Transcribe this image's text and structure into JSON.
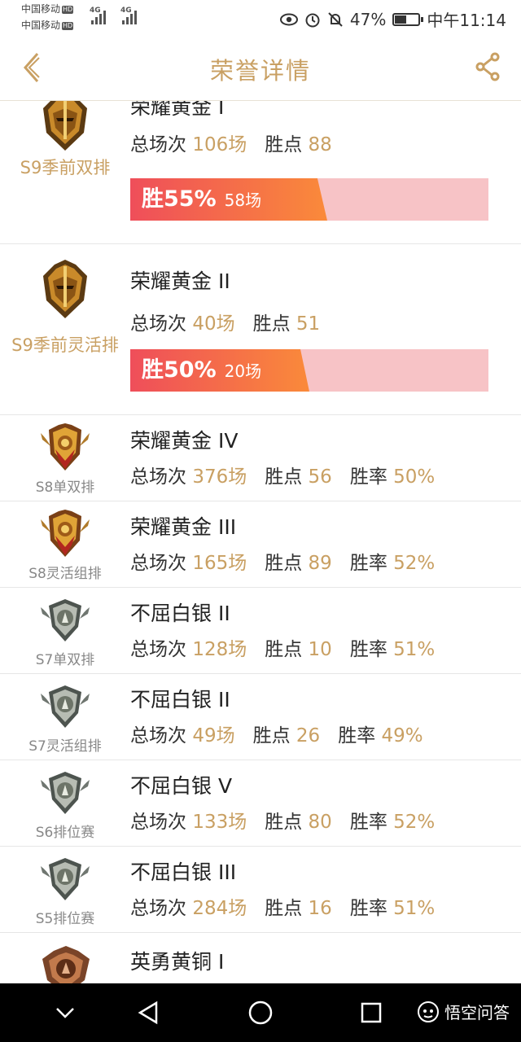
{
  "status_bar": {
    "carrier1": "中国移动",
    "carrier2": "中国移动",
    "hd": "HD",
    "net1": "4G",
    "net2": "4G",
    "battery": "47%",
    "time": "中午11:14"
  },
  "header": {
    "title": "荣誉详情",
    "accent": "#c9a063"
  },
  "rows_big": [
    {
      "season": "S9季前双排",
      "rank": "荣耀黄金 I",
      "total_label": "总场次",
      "total": "106场",
      "points_label": "胜点",
      "points": "88",
      "win_pct_text": "胜55%",
      "win_games": "58场",
      "win_fraction": 0.55
    },
    {
      "season": "S9季前灵活排",
      "rank": "荣耀黄金 II",
      "total_label": "总场次",
      "total": "40场",
      "points_label": "胜点",
      "points": "51",
      "win_pct_text": "胜50%",
      "win_games": "20场",
      "win_fraction": 0.5
    }
  ],
  "rows_small": [
    {
      "season": "S8单双排",
      "rank": "荣耀黄金 IV",
      "total_label": "总场次",
      "total": "376场",
      "points_label": "胜点",
      "points": "56",
      "rate_label": "胜率",
      "rate": "50%",
      "tier": "gold"
    },
    {
      "season": "S8灵活组排",
      "rank": "荣耀黄金 III",
      "total_label": "总场次",
      "total": "165场",
      "points_label": "胜点",
      "points": "89",
      "rate_label": "胜率",
      "rate": "52%",
      "tier": "gold"
    },
    {
      "season": "S7单双排",
      "rank": "不屈白银 II",
      "total_label": "总场次",
      "total": "128场",
      "points_label": "胜点",
      "points": "10",
      "rate_label": "胜率",
      "rate": "51%",
      "tier": "silver"
    },
    {
      "season": "S7灵活组排",
      "rank": "不屈白银 II",
      "total_label": "总场次",
      "total": "49场",
      "points_label": "胜点",
      "points": "26",
      "rate_label": "胜率",
      "rate": "49%",
      "tier": "silver"
    },
    {
      "season": "S6排位赛",
      "rank": "不屈白银 V",
      "total_label": "总场次",
      "total": "133场",
      "points_label": "胜点",
      "points": "80",
      "rate_label": "胜率",
      "rate": "52%",
      "tier": "silver"
    },
    {
      "season": "S5排位赛",
      "rank": "不屈白银 III",
      "total_label": "总场次",
      "total": "284场",
      "points_label": "胜点",
      "points": "16",
      "rate_label": "胜率",
      "rate": "51%",
      "tier": "silver"
    }
  ],
  "row_partial": {
    "rank": "英勇黄铜 I",
    "tier": "bronze"
  },
  "watermark": "悟空问答",
  "icons": [
    "back-chevron-icon",
    "share-icon",
    "eye-icon",
    "alarm-icon",
    "mute-bell-icon",
    "battery-icon",
    "nav-back-icon",
    "nav-home-icon",
    "nav-recent-icon",
    "nav-collapse-icon"
  ]
}
